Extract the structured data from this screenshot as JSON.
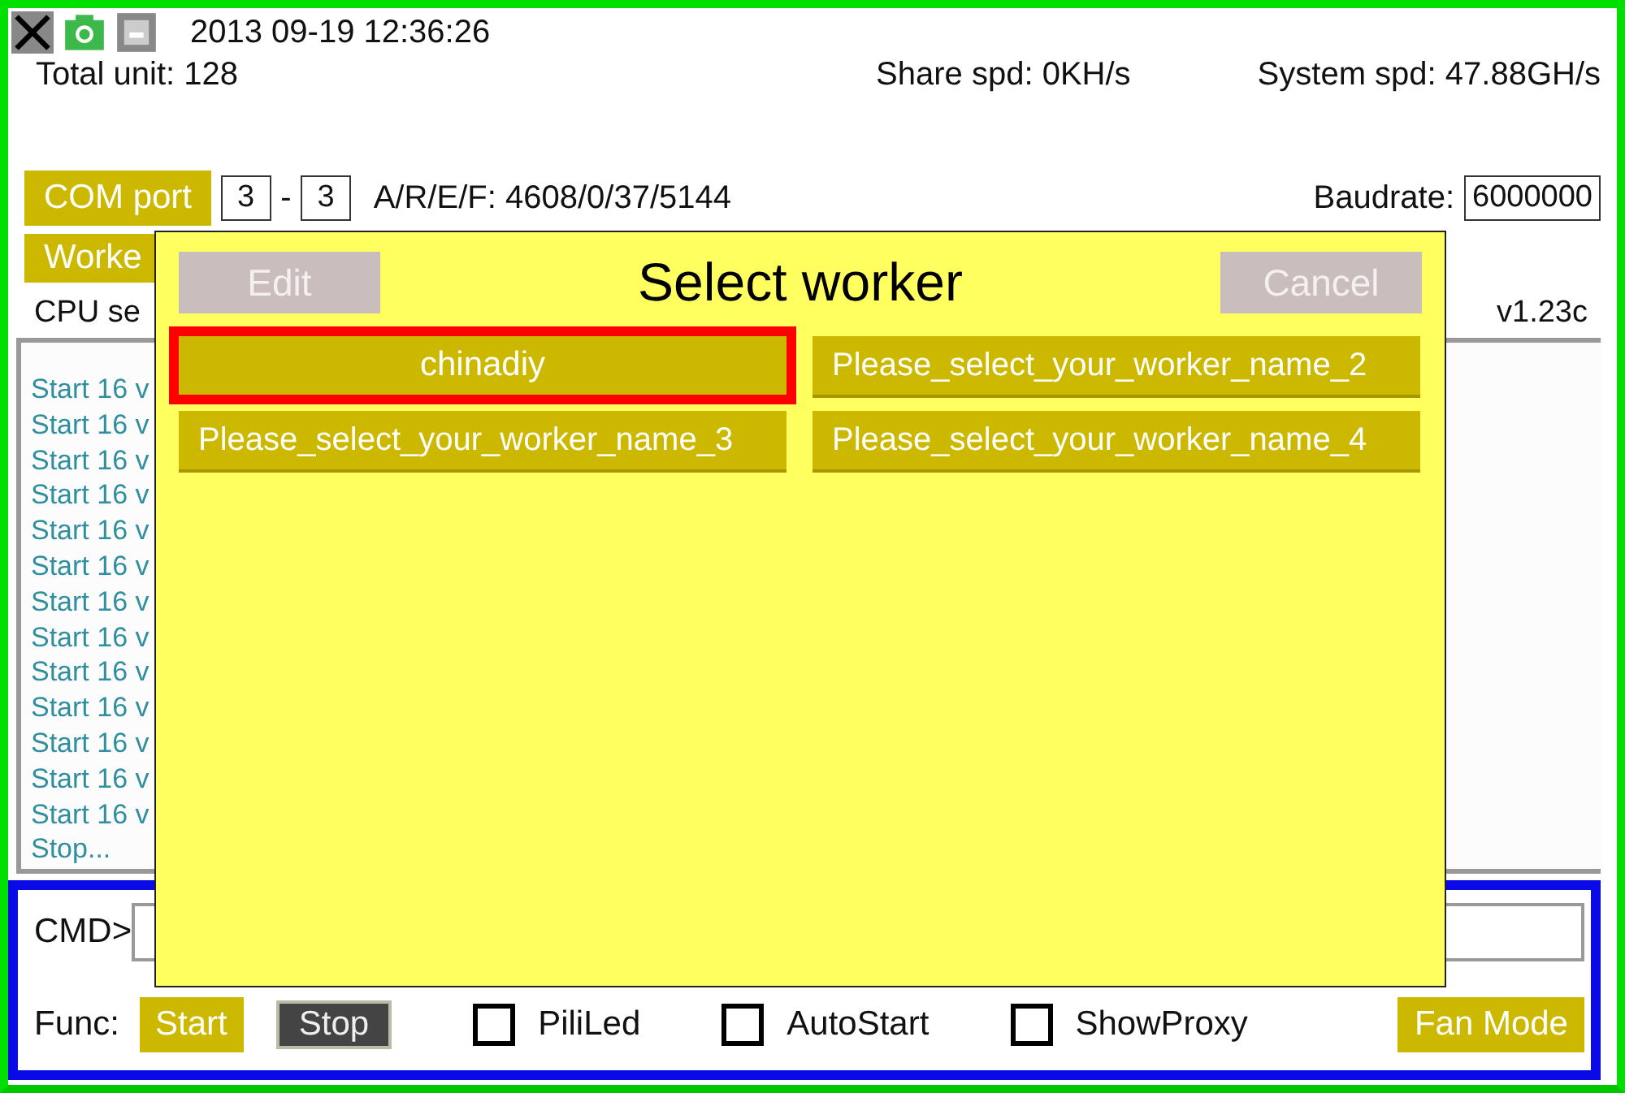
{
  "header": {
    "datetime": "2013 09-19 12:36:26",
    "total_unit": "Total unit: 128",
    "share_speed": "Share spd: 0KH/s",
    "system_speed": "System spd: 47.88GH/s"
  },
  "com": {
    "button": "COM port",
    "from": "3",
    "separator": "-",
    "to": "3",
    "aref": "A/R/E/F: 4608/0/37/5144",
    "baudrate_label": "Baudrate:",
    "baudrate": "6000000"
  },
  "worker_button": "Worke",
  "cpu_label": "CPU se",
  "version": "v1.23c",
  "log": [
    "Start 16 v",
    "Start 16 v",
    "Start 16 v",
    "Start 16 v",
    "Start 16 v",
    "Start 16 v",
    "Start 16 v",
    "Start 16 v",
    "Start 16 v",
    "Start 16 v",
    "Start 16 v",
    "Start 16 v",
    "Start 16 v",
    "Stop..."
  ],
  "cmd_label": "CMD>",
  "func": {
    "label": "Func:",
    "start": "Start",
    "stop": "Stop",
    "mode": "Fan Mode"
  },
  "checkboxes": [
    {
      "label": "PiliLed",
      "checked": false
    },
    {
      "label": "AutoStart",
      "checked": false
    },
    {
      "label": "ShowProxy",
      "checked": false
    }
  ],
  "dialog": {
    "title": "Select worker",
    "edit": "Edit",
    "cancel": "Cancel",
    "workers": [
      {
        "name": "chinadiy",
        "selected": true
      },
      {
        "name": "Please_select_your_worker_name_2",
        "selected": false
      },
      {
        "name": "Please_select_your_worker_name_3",
        "selected": false
      },
      {
        "name": "Please_select_your_worker_name_4",
        "selected": false
      }
    ]
  }
}
